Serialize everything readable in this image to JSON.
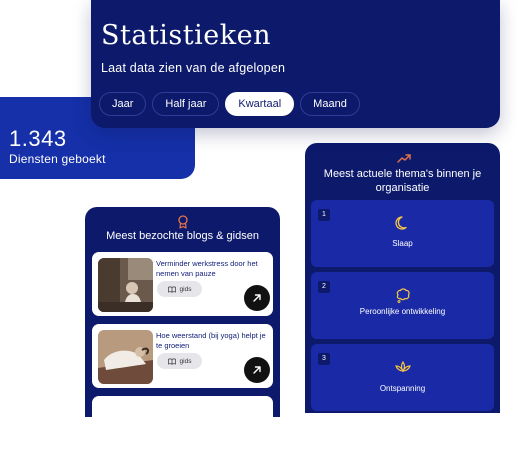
{
  "stats": {
    "title": "Statistieken",
    "subtitle": "Laat data zien van de afgelopen",
    "tabs": [
      {
        "label": "Jaar",
        "active": false
      },
      {
        "label": "Half jaar",
        "active": false
      },
      {
        "label": "Kwartaal",
        "active": true
      },
      {
        "label": "Maand",
        "active": false
      }
    ]
  },
  "diensten": {
    "number": "1.343",
    "label": "Diensten geboekt"
  },
  "blogs": {
    "title": "Meest bezochte blogs & gidsen",
    "items": [
      {
        "title": "Verminder werkstress door het nemen van pauze",
        "tag": "gids"
      },
      {
        "title": "Hoe weerstand (bij yoga) helpt je te groeien",
        "tag": "gids"
      }
    ]
  },
  "themes": {
    "title": "Meest actuele thema's binnen je organisatie",
    "items": [
      {
        "rank": "1",
        "label": "Slaap",
        "icon": "moon-icon"
      },
      {
        "rank": "2",
        "label": "Peroonlijke ontwikkeling",
        "icon": "thought-bubble-icon"
      },
      {
        "rank": "3",
        "label": "Ontspanning",
        "icon": "lotus-icon"
      }
    ]
  },
  "colors": {
    "navy": "#0d1a6b",
    "blue": "#1530a8",
    "tile": "#1a2aa6",
    "accent": "#e8734a",
    "white": "#ffffff"
  }
}
